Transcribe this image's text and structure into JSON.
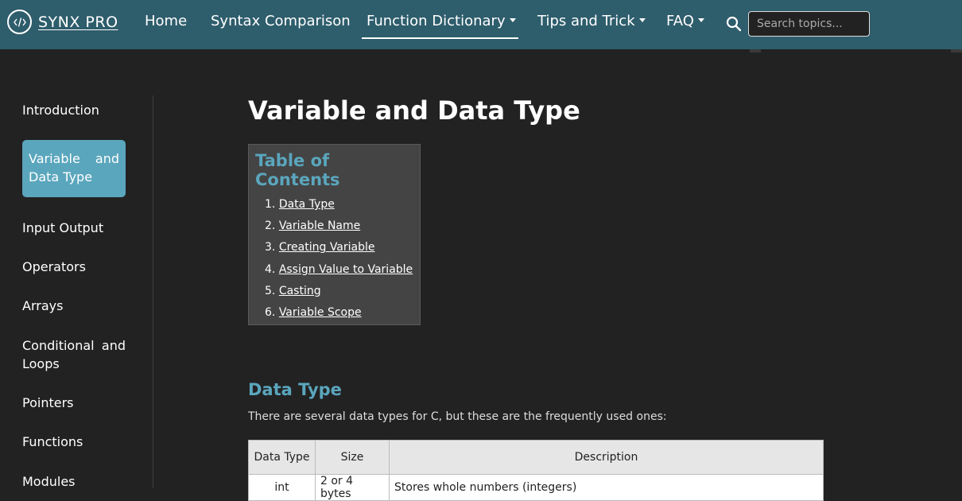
{
  "navbar": {
    "brand": "SYNX PRO",
    "items": [
      {
        "label": "Home"
      },
      {
        "label": "Syntax Comparison"
      },
      {
        "label": "Function Dictionary"
      },
      {
        "label": "Tips and Trick"
      },
      {
        "label": "FAQ"
      }
    ],
    "search_placeholder": "Search topics..."
  },
  "sidebar": {
    "items": [
      {
        "label": "Introduction"
      },
      {
        "label": "Variable and Data Type",
        "line1_a": "Variable",
        "line1_b": "and",
        "line2": "Data Type",
        "active": true
      },
      {
        "label": "Input Output"
      },
      {
        "label": "Operators"
      },
      {
        "label": "Arrays"
      },
      {
        "label": "Conditional and Loops",
        "line1_a": "Conditional",
        "line1_b": "and",
        "line2": "Loops"
      },
      {
        "label": "Pointers"
      },
      {
        "label": "Functions"
      },
      {
        "label": "Modules"
      }
    ]
  },
  "main": {
    "title": "Variable and Data Type",
    "toc": {
      "title": "Table of Contents",
      "items": [
        {
          "num": "1.",
          "label": "Data Type"
        },
        {
          "num": "2.",
          "label": "Variable Name"
        },
        {
          "num": "3.",
          "label": "Creating Variable"
        },
        {
          "num": "4.",
          "label": "Assign Value to Variable"
        },
        {
          "num": "5.",
          "label": "Casting"
        },
        {
          "num": "6.",
          "label": "Variable Scope"
        }
      ]
    },
    "section": {
      "title": "Data Type",
      "text": "There are several data types for C, but these are the frequently used ones:"
    },
    "table": {
      "headers": [
        "Data Type",
        "Size",
        "Description"
      ],
      "rows": [
        [
          "int",
          "2 or 4 bytes",
          "Stores whole numbers (integers)"
        ]
      ]
    }
  },
  "colors": {
    "navbar_bg": "#2e5d6c",
    "accent": "#5aa6bd",
    "page_bg": "#222222"
  }
}
